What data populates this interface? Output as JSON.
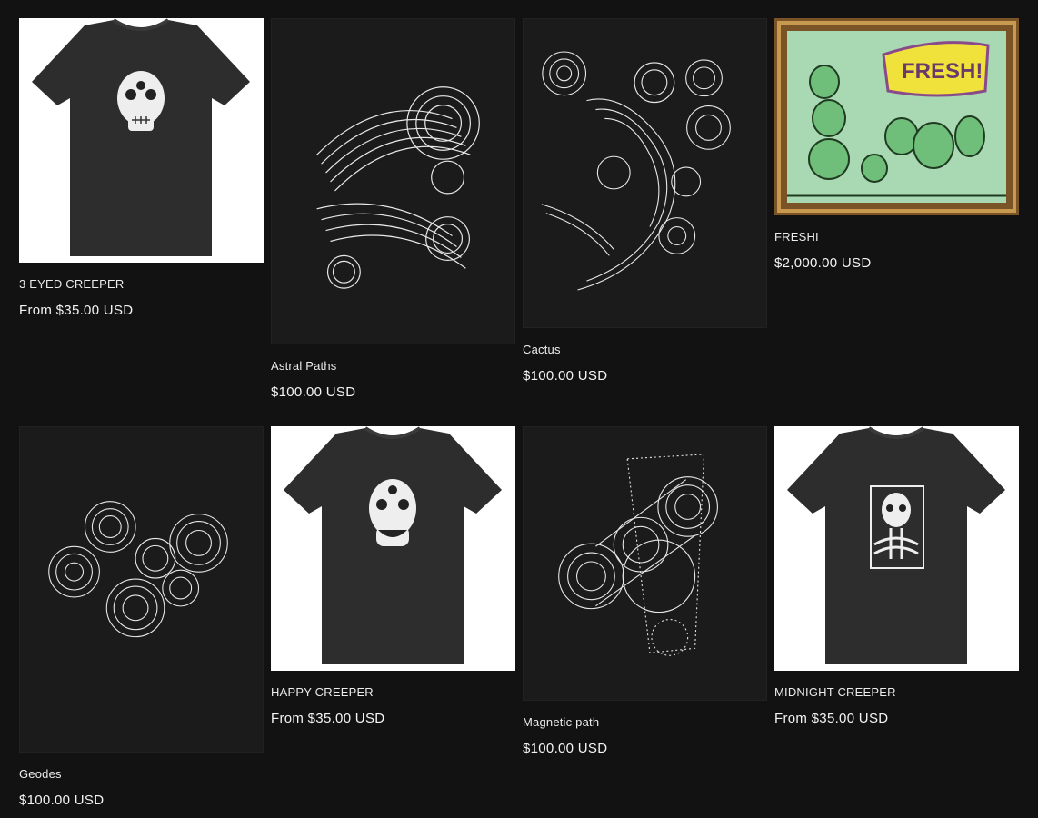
{
  "products": [
    {
      "title": "3 EYED CREEPER",
      "price": "From $35.00 USD",
      "image": "tshirt-skull-three-eyes"
    },
    {
      "title": "Astral Paths",
      "price": "$100.00 USD",
      "image": "line-art-tubes"
    },
    {
      "title": "Cactus",
      "price": "$100.00 USD",
      "image": "line-art-cactus"
    },
    {
      "title": "FRESHI",
      "price": "$2,000.00 USD",
      "image": "framed-graffiti-painting"
    },
    {
      "title": "Geodes",
      "price": "$100.00 USD",
      "image": "line-art-geodes"
    },
    {
      "title": "HAPPY CREEPER",
      "price": "From $35.00 USD",
      "image": "tshirt-skull-happy"
    },
    {
      "title": "Magnetic path",
      "price": "$100.00 USD",
      "image": "line-art-spheres-dots"
    },
    {
      "title": "MIDNIGHT CREEPER",
      "price": "From $35.00 USD",
      "image": "tshirt-skull-skeleton"
    }
  ],
  "colors": {
    "background": "#121212",
    "text": "#f2f2f2",
    "shirt": "#2b2b2b"
  }
}
